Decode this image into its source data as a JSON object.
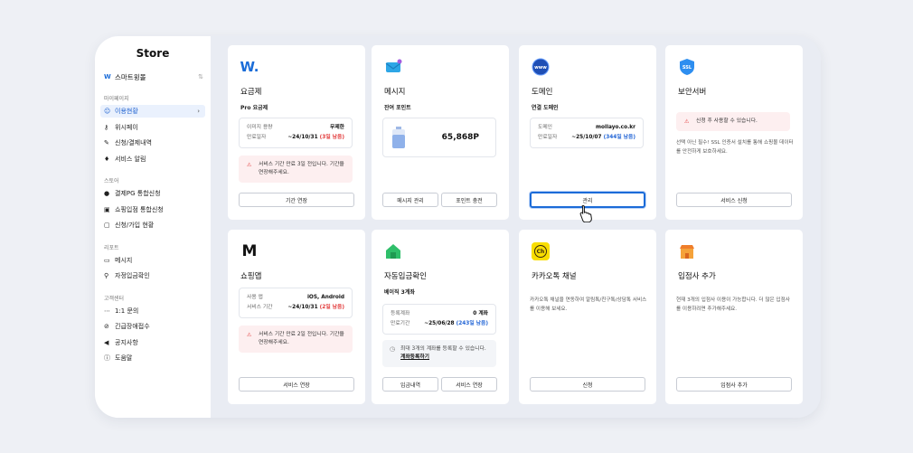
{
  "sidebar": {
    "title": "Store",
    "store": {
      "name": "스마트윙몰",
      "logo": "W"
    },
    "sections": [
      {
        "label": "마이페이지",
        "items": [
          {
            "label": "이용현황",
            "icon": "smile-icon",
            "glyph": "☺",
            "active": true
          },
          {
            "label": "위시페이",
            "icon": "key-icon",
            "glyph": "⚷"
          },
          {
            "label": "신청/결제내역",
            "icon": "document-icon",
            "glyph": "✎"
          },
          {
            "label": "서비스 알림",
            "icon": "bell-icon",
            "glyph": "♦"
          }
        ]
      },
      {
        "label": "스토어",
        "items": [
          {
            "label": "결제PG 통합신청",
            "icon": "moneybag-icon",
            "glyph": "●"
          },
          {
            "label": "쇼핑입점 통합신청",
            "icon": "cart-icon",
            "glyph": "▣"
          },
          {
            "label": "신청/가입 현황",
            "icon": "clipboard-icon",
            "glyph": "▢"
          }
        ]
      },
      {
        "label": "리포트",
        "items": [
          {
            "label": "메시지",
            "icon": "keyboard-icon",
            "glyph": "▭"
          },
          {
            "label": "자정입금확인",
            "icon": "magnifier-icon",
            "glyph": "⚲"
          }
        ]
      },
      {
        "label": "고객센터",
        "items": [
          {
            "label": "1:1 문의",
            "icon": "chat-icon",
            "glyph": "⋯"
          },
          {
            "label": "긴급장애접수",
            "icon": "prohibited-icon",
            "glyph": "⊘"
          },
          {
            "label": "공지사항",
            "icon": "megaphone-icon",
            "glyph": "◀"
          },
          {
            "label": "도움말",
            "icon": "info-icon",
            "glyph": "ⓘ"
          }
        ]
      }
    ]
  },
  "cards": [
    {
      "name": "요금제",
      "subtitle": "Pro 요금제",
      "icon": "w-logo-icon",
      "rows": [
        {
          "k": "이미지 용량",
          "v": "무제한"
        },
        {
          "k": "만료일자",
          "v": "~24/10/31 ",
          "hl": "(3일 남음)",
          "hlc": "red"
        }
      ],
      "warning": "서비스 기간 만료 3일 전입니다. 기간을 연장해주세요.",
      "buttons": [
        "기간 연장"
      ]
    },
    {
      "name": "메시지",
      "subtitle": "잔여 포인트",
      "icon": "envelope-icon",
      "points": "65,868P",
      "buttons": [
        "메시지 관리",
        "포인트 충전"
      ]
    },
    {
      "name": "도메인",
      "subtitle": "연결 도메인",
      "icon": "www-icon",
      "rows": [
        {
          "k": "도메인",
          "v": "mollayo.co.kr"
        },
        {
          "k": "만료일자",
          "v": "~25/10/07 ",
          "hl": "(344일 남음)",
          "hlc": "blue"
        }
      ],
      "buttons": [
        "관리"
      ]
    },
    {
      "name": "보안서버",
      "icon": "ssl-shield-icon",
      "warning": "신청 후 사용할 수 있습니다.",
      "desc": "선택 아닌 필수! SSL 인증서 설치를 통해 쇼핑몰 데이터를 안전하게 보호하세요.",
      "buttons": [
        "서비스 신청"
      ]
    },
    {
      "name": "쇼핑앱",
      "icon": "m-logo-icon",
      "rows": [
        {
          "k": "사용 앱",
          "v": "iOS, Android"
        },
        {
          "k": "서비스 기간",
          "v": "~24/10/31 ",
          "hl": "(2일 남음)",
          "hlc": "red"
        }
      ],
      "warning": "서비스 기간 만료 2일 전입니다. 기간을 연장해주세요.",
      "buttons": [
        "서비스 연장"
      ]
    },
    {
      "name": "자동입금확인",
      "subtitle": "베이직 3계좌",
      "icon": "house-icon",
      "rows": [
        {
          "k": "등록계좌",
          "v": "0 계좌"
        },
        {
          "k": "만료기간",
          "v": "~25/06/28 ",
          "hl": "(243일 남음)",
          "hlc": "blue"
        }
      ],
      "note": "최대 3개의 계좌를 등록할 수 있습니다.",
      "note_link": "계좌등록하기",
      "buttons": [
        "입금내역",
        "서비스 연장"
      ]
    },
    {
      "name": "카카오톡 채널",
      "icon": "kakao-ch-icon",
      "desc": "카카오톡 채널을 연동하여 알림톡/친구톡/상담톡 서비스를 이용해 보세요.",
      "buttons": [
        "신청"
      ]
    },
    {
      "name": "입점사 추가",
      "icon": "store-icon",
      "desc": "현재 3개의 입점사 이용이 가능합니다. 더 많은 입점사를 이용하려면 추가해주세요.",
      "buttons": [
        "입점사 추가"
      ]
    }
  ],
  "colors": {
    "accent": "#1b6bd8",
    "warning_bg": "#fdeff0",
    "warning_text": "#e23a3a",
    "highlight_blue": "#2466d6"
  }
}
